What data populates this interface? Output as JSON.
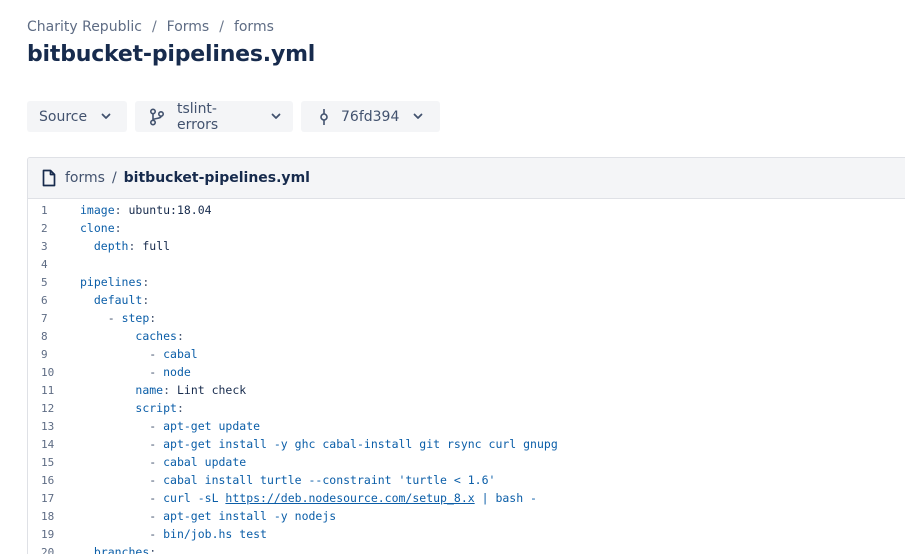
{
  "breadcrumb": {
    "items": [
      "Charity Republic",
      "Forms",
      "forms"
    ],
    "separator": "/"
  },
  "page_title": "bitbucket-pipelines.yml",
  "toolbar": {
    "source_label": "Source",
    "branch_label": "tslint-errors",
    "commit_label": "76fd394"
  },
  "file_header": {
    "dir": "forms",
    "separator": "/",
    "filename": "bitbucket-pipelines.yml"
  },
  "colors": {
    "key": "#0b5ea8",
    "text": "#172b4d",
    "muted": "#5e6c84",
    "panel_bg": "#f4f5f7",
    "border": "#dfe1e6"
  },
  "icons": {
    "chevron": "chevron-down-icon",
    "branch": "branch-icon",
    "commit": "commit-icon",
    "file": "file-icon"
  },
  "code_lines": [
    {
      "n": "1",
      "indent": 0,
      "key": "image",
      "value": "ubuntu:18.04"
    },
    {
      "n": "2",
      "indent": 0,
      "key": "clone",
      "value": ""
    },
    {
      "n": "3",
      "indent": 2,
      "key": "depth",
      "value": "full"
    },
    {
      "n": "4",
      "indent": 0,
      "key": "",
      "value": ""
    },
    {
      "n": "5",
      "indent": 0,
      "key": "pipelines",
      "value": ""
    },
    {
      "n": "6",
      "indent": 2,
      "key": "default",
      "value": ""
    },
    {
      "n": "7",
      "indent": 4,
      "dash": true,
      "key": "step",
      "value": ""
    },
    {
      "n": "8",
      "indent": 8,
      "key": "caches",
      "value": ""
    },
    {
      "n": "9",
      "indent": 10,
      "dash": true,
      "key": "",
      "value": "cabal"
    },
    {
      "n": "10",
      "indent": 10,
      "dash": true,
      "key": "",
      "value": "node"
    },
    {
      "n": "11",
      "indent": 8,
      "key": "name",
      "value": "Lint check"
    },
    {
      "n": "12",
      "indent": 8,
      "key": "script",
      "value": ""
    },
    {
      "n": "13",
      "indent": 10,
      "dash": true,
      "key": "",
      "value": "apt-get update"
    },
    {
      "n": "14",
      "indent": 10,
      "dash": true,
      "key": "",
      "value": "apt-get install -y ghc cabal-install git rsync curl gnupg"
    },
    {
      "n": "15",
      "indent": 10,
      "dash": true,
      "key": "",
      "value": "cabal update"
    },
    {
      "n": "16",
      "indent": 10,
      "dash": true,
      "key": "",
      "value": "cabal install turtle --constraint 'turtle < 1.6'"
    },
    {
      "n": "17",
      "indent": 10,
      "dash": true,
      "key": "",
      "value": "curl -sL ",
      "link": "https://deb.nodesource.com/setup_8.x",
      "after": " | bash -"
    },
    {
      "n": "18",
      "indent": 10,
      "dash": true,
      "key": "",
      "value": "apt-get install -y nodejs"
    },
    {
      "n": "19",
      "indent": 10,
      "dash": true,
      "key": "",
      "value": "bin/job.hs test"
    },
    {
      "n": "20",
      "indent": 2,
      "key": "branches",
      "value": ""
    }
  ]
}
